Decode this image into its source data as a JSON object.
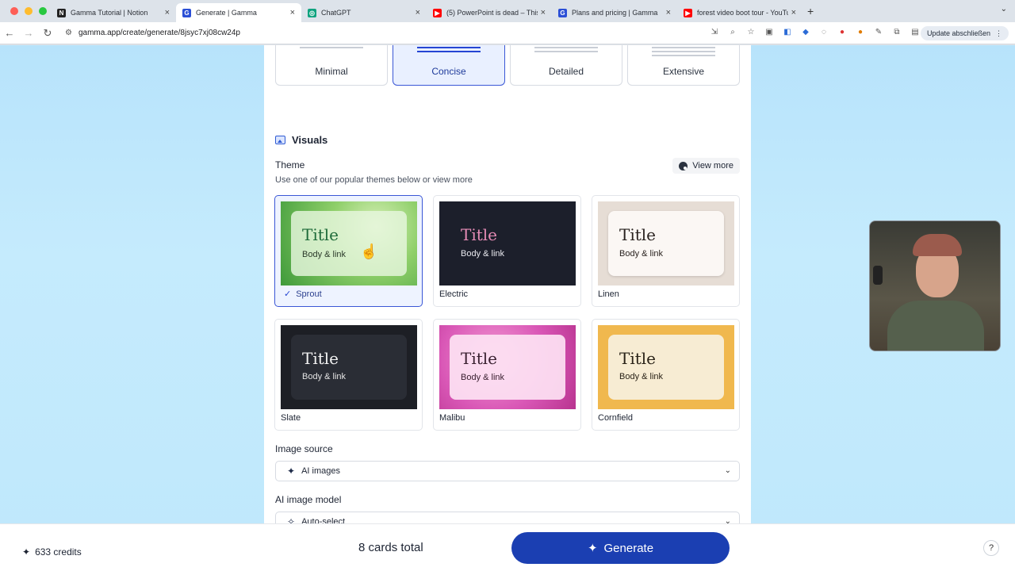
{
  "browser": {
    "tabs": [
      {
        "title": "Gamma Tutorial | Notion",
        "icon": "notion-icon",
        "color": "#222222",
        "glyph": "N"
      },
      {
        "title": "Generate | Gamma",
        "icon": "gamma-icon",
        "color": "#2b4fd6",
        "glyph": "G",
        "active": true
      },
      {
        "title": "ChatGPT",
        "icon": "chatgpt-icon",
        "color": "#10a37f",
        "glyph": "◎"
      },
      {
        "title": "(5) PowerPoint is dead – This",
        "icon": "youtube-icon",
        "color": "#ff0000",
        "glyph": "▶"
      },
      {
        "title": "Plans and pricing | Gamma",
        "icon": "gamma-icon",
        "color": "#2b4fd6",
        "glyph": "G"
      },
      {
        "title": "forest video boot tour - YouTu",
        "icon": "youtube-icon",
        "color": "#ff0000",
        "glyph": "▶"
      }
    ],
    "url": "gamma.app/create/generate/8jsyc7xj08cw24p",
    "update_label": "Update abschließen"
  },
  "card_density": {
    "options": [
      "Minimal",
      "Concise",
      "Detailed",
      "Extensive"
    ],
    "selected": "Concise"
  },
  "visuals": {
    "section_title": "Visuals",
    "theme_label": "Theme",
    "theme_hint": "Use one of our popular themes below or view more",
    "view_more": "View more",
    "themes": [
      {
        "name": "Sprout",
        "title": "Title",
        "body": "Body & link",
        "selected": true
      },
      {
        "name": "Electric",
        "title": "Title",
        "body": "Body & link"
      },
      {
        "name": "Linen",
        "title": "Title",
        "body": "Body & link"
      },
      {
        "name": "Slate",
        "title": "Title",
        "body": "Body & link"
      },
      {
        "name": "Malibu",
        "title": "Title",
        "body": "Body & link"
      },
      {
        "name": "Cornfield",
        "title": "Title",
        "body": "Body & link"
      }
    ],
    "image_source_label": "Image source",
    "image_source_value": "AI images",
    "image_model_label": "AI image model",
    "image_model_value": "Auto-select"
  },
  "footer": {
    "credits": "633 credits",
    "cards_total": "8 cards total",
    "generate": "Generate",
    "help": "?"
  },
  "colors": {
    "accent": "#1b3fb2",
    "selected_border": "#3a57d6",
    "page_bg": "#bfe8fc"
  }
}
